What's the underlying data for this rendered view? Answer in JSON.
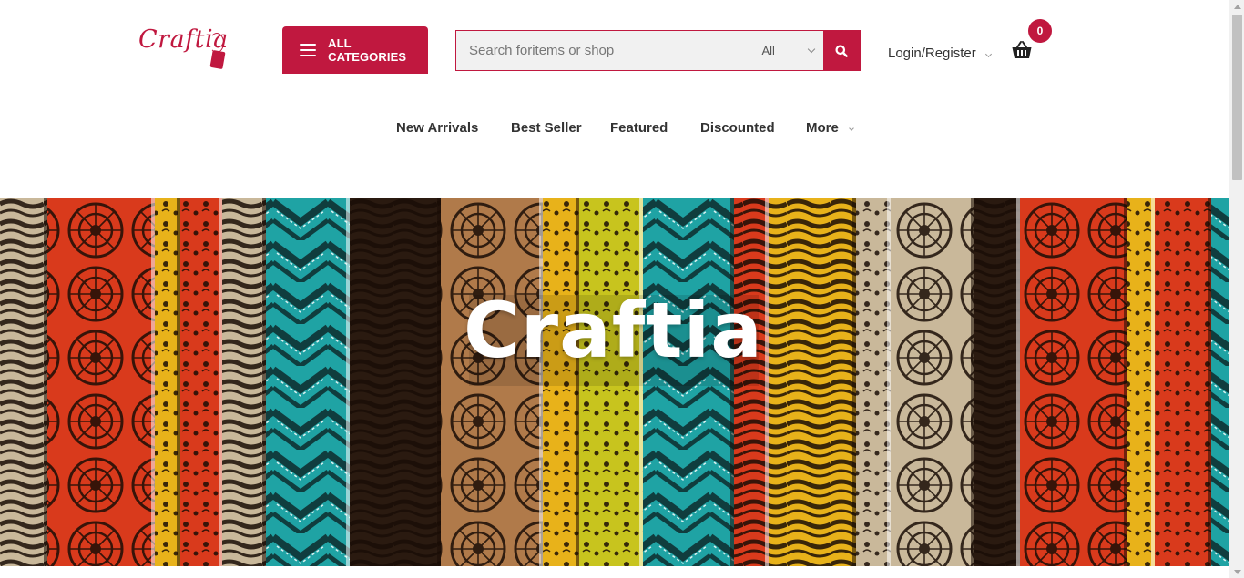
{
  "header": {
    "logo_text": "Craftia",
    "categories_label": "ALL CATEGORIES",
    "search": {
      "placeholder": "Search foritems or shop",
      "value": "",
      "category_selected": "All"
    },
    "login_label": "Login/Register",
    "cart_count": "0"
  },
  "nav": {
    "items": [
      {
        "label": "New Arrivals"
      },
      {
        "label": "Best Seller"
      },
      {
        "label": "Featured"
      },
      {
        "label": "Discounted"
      },
      {
        "label": "More"
      }
    ]
  },
  "hero": {
    "title": "Craftia"
  },
  "colors": {
    "brand": "#c0183f",
    "pattern_red": "#d93a1c",
    "pattern_teal": "#1fa3a4",
    "pattern_yellow": "#e8b21a",
    "pattern_tan": "#c9b89a",
    "pattern_dark": "#2a1a10"
  },
  "icons": {
    "menu": "hamburger-icon",
    "search": "search-icon",
    "cart": "basket-icon",
    "dropdown": "chevron-down-icon"
  }
}
